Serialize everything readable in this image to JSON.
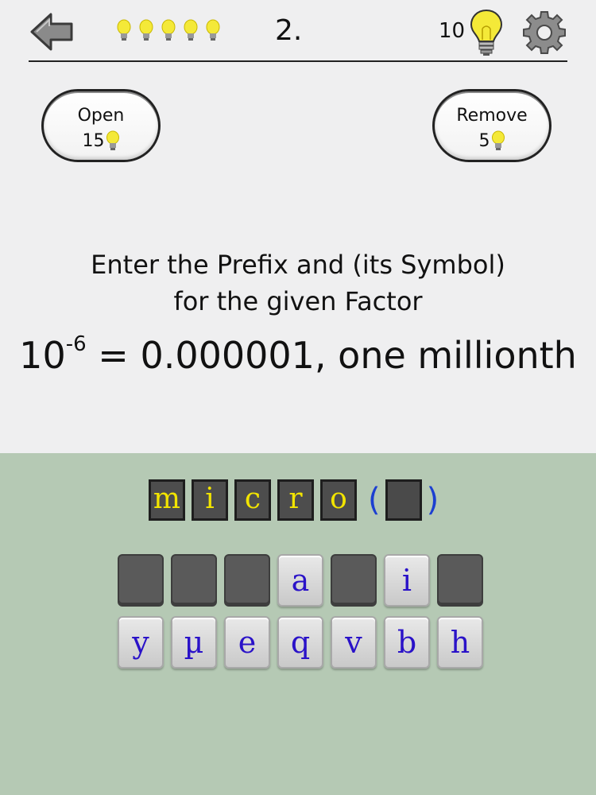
{
  "header": {
    "level": "2.",
    "bulbs_count": 5,
    "coins": "10"
  },
  "hints": {
    "open": {
      "label": "Open",
      "cost": "15"
    },
    "remove": {
      "label": "Remove",
      "cost": "5"
    }
  },
  "prompt": {
    "line1": "Enter the Prefix and (its Symbol)",
    "line2": "for the given Factor",
    "factor_base": "10",
    "factor_exp": "-6",
    "factor_rest": " = 0.000001, one millionth"
  },
  "answer": {
    "letters": [
      "m",
      "i",
      "c",
      "r",
      "o"
    ],
    "open_paren": "(",
    "close_paren": ")"
  },
  "keyboard": {
    "row1": [
      "",
      "",
      "",
      "a",
      "",
      "i",
      ""
    ],
    "row2": [
      "y",
      "µ",
      "e",
      "q",
      "v",
      "b",
      "h"
    ]
  },
  "colors": {
    "accent_text": "#2a12c8",
    "answer_text": "#f2e400",
    "bottom_bg": "#b5c9b4"
  }
}
